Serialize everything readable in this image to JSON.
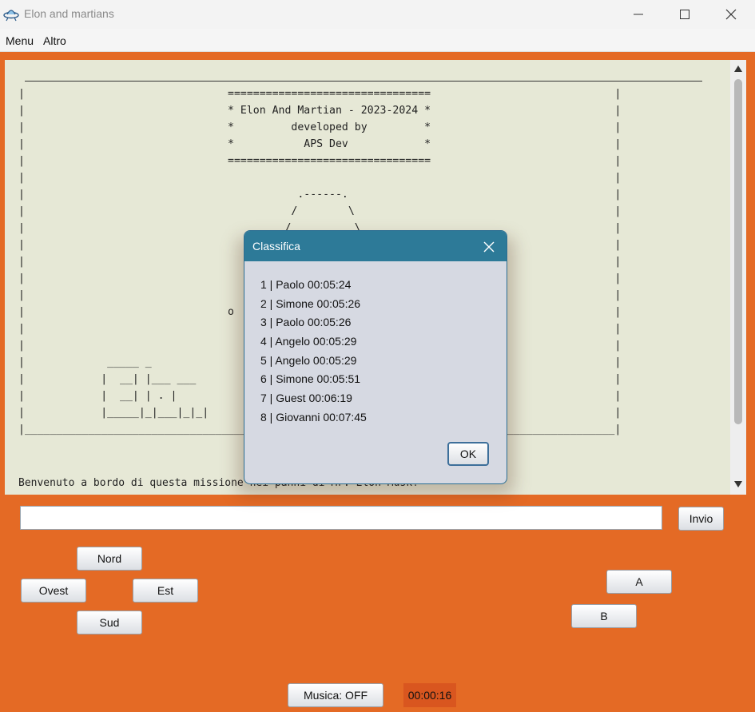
{
  "window": {
    "title": "Elon and martians",
    "icon": "alien-ship-icon",
    "controls": [
      "minimize-icon",
      "maximize-icon",
      "close-icon"
    ]
  },
  "menubar": {
    "items": [
      "Menu",
      "Altro"
    ]
  },
  "console": {
    "ascii_lines": [
      "|                                ================================                             |",
      "|                                * Elon And Martian - 2023-2024 *                             |",
      "|                                *         developed by         *                             |",
      "|                                *           APS Dev            *                             |",
      "|                                ================================                             |",
      "|                                                                                             |",
      "|                                           .------.                                          |",
      "|                                          /        \\                                         |",
      "|                                         /          \\                                        |",
      "|                                                                                             |",
      "|                                                                                             |",
      "|                                                                                             |",
      "|                                                                                             |",
      "|                                o                                                            |",
      "|                                                                                             |",
      "|                                                                                             |",
      "|             _____ _                                          _                              |",
      "|            |  __| |___ ___                                  |___ ___ ___                    |",
      "|            |  __| | . |                                      | .'|   |_ -|                  |",
      "|            |_____|_|___|_|_|                                 |__,|_|_|___|                  |",
      "|_____________________________________________________________________________________________|"
    ],
    "welcome": "Benvenuto a bordo di questa missione nei panni di Mr. Elon Musk!"
  },
  "command": {
    "input_value": "",
    "send_label": "Invio"
  },
  "directions": {
    "north": "Nord",
    "west": "Ovest",
    "east": "Est",
    "south": "Sud"
  },
  "choices": {
    "a": "A",
    "b": "B"
  },
  "footer": {
    "music_label": "Musica: OFF",
    "timer": "00:00:16"
  },
  "dialog": {
    "title": "Classifica",
    "entries": [
      "1 | Paolo 00:05:24",
      "2 | Simone 00:05:26",
      "3 | Paolo 00:05:26",
      "4 | Angelo 00:05:29",
      "5 | Angelo 00:05:29",
      "6 | Simone 00:05:51",
      "7 | Guest 00:06:19",
      "8 | Giovanni 00:07:45"
    ],
    "ok_label": "OK"
  },
  "colors": {
    "background": "#e46a25",
    "console": "#e6e8d6",
    "dialog_header": "#2d7a98",
    "timer_bg": "#d9561f"
  }
}
